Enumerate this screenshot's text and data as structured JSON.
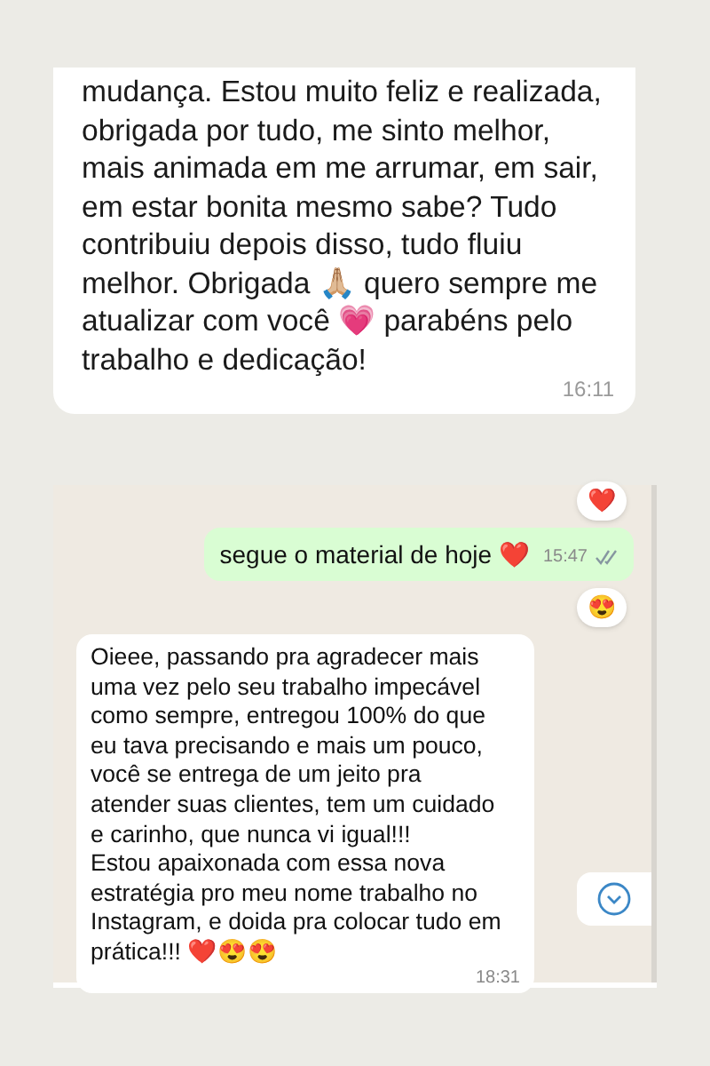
{
  "first_screenshot": {
    "message": {
      "text": "mudança. Estou muito feliz e realizada, obrigada por tudo, me sinto melhor, mais animada em me arrumar, em sair, em estar bonita mesmo sabe? Tudo contribuiu depois disso, tudo fluiu melhor. Obrigada 🙏🏼 quero sempre me atualizar com você 💗 parabéns pelo trabalho e dedicação!",
      "time": "16:11"
    }
  },
  "second_screenshot": {
    "messages": [
      {
        "kind": "reaction",
        "emoji": "❤️"
      },
      {
        "kind": "outgoing",
        "text": "segue o material de hoje ❤️",
        "time": "15:47"
      },
      {
        "kind": "reaction",
        "emoji": "😍"
      },
      {
        "kind": "incoming",
        "text": "Oieee, passando pra agradecer mais uma vez pelo seu trabalho impecável como sempre, entregou 100% do que eu tava precisando e mais um pouco, você se entrega de um jeito pra atender suas clientes, tem um cuidado e carinho, que nunca vi igual!!!\nEstou apaixonada com essa nova estratégia pro meu nome trabalho no Instagram, e doida pra colocar tudo em prática!!! ❤️😍😍",
        "time": "18:31"
      }
    ]
  }
}
